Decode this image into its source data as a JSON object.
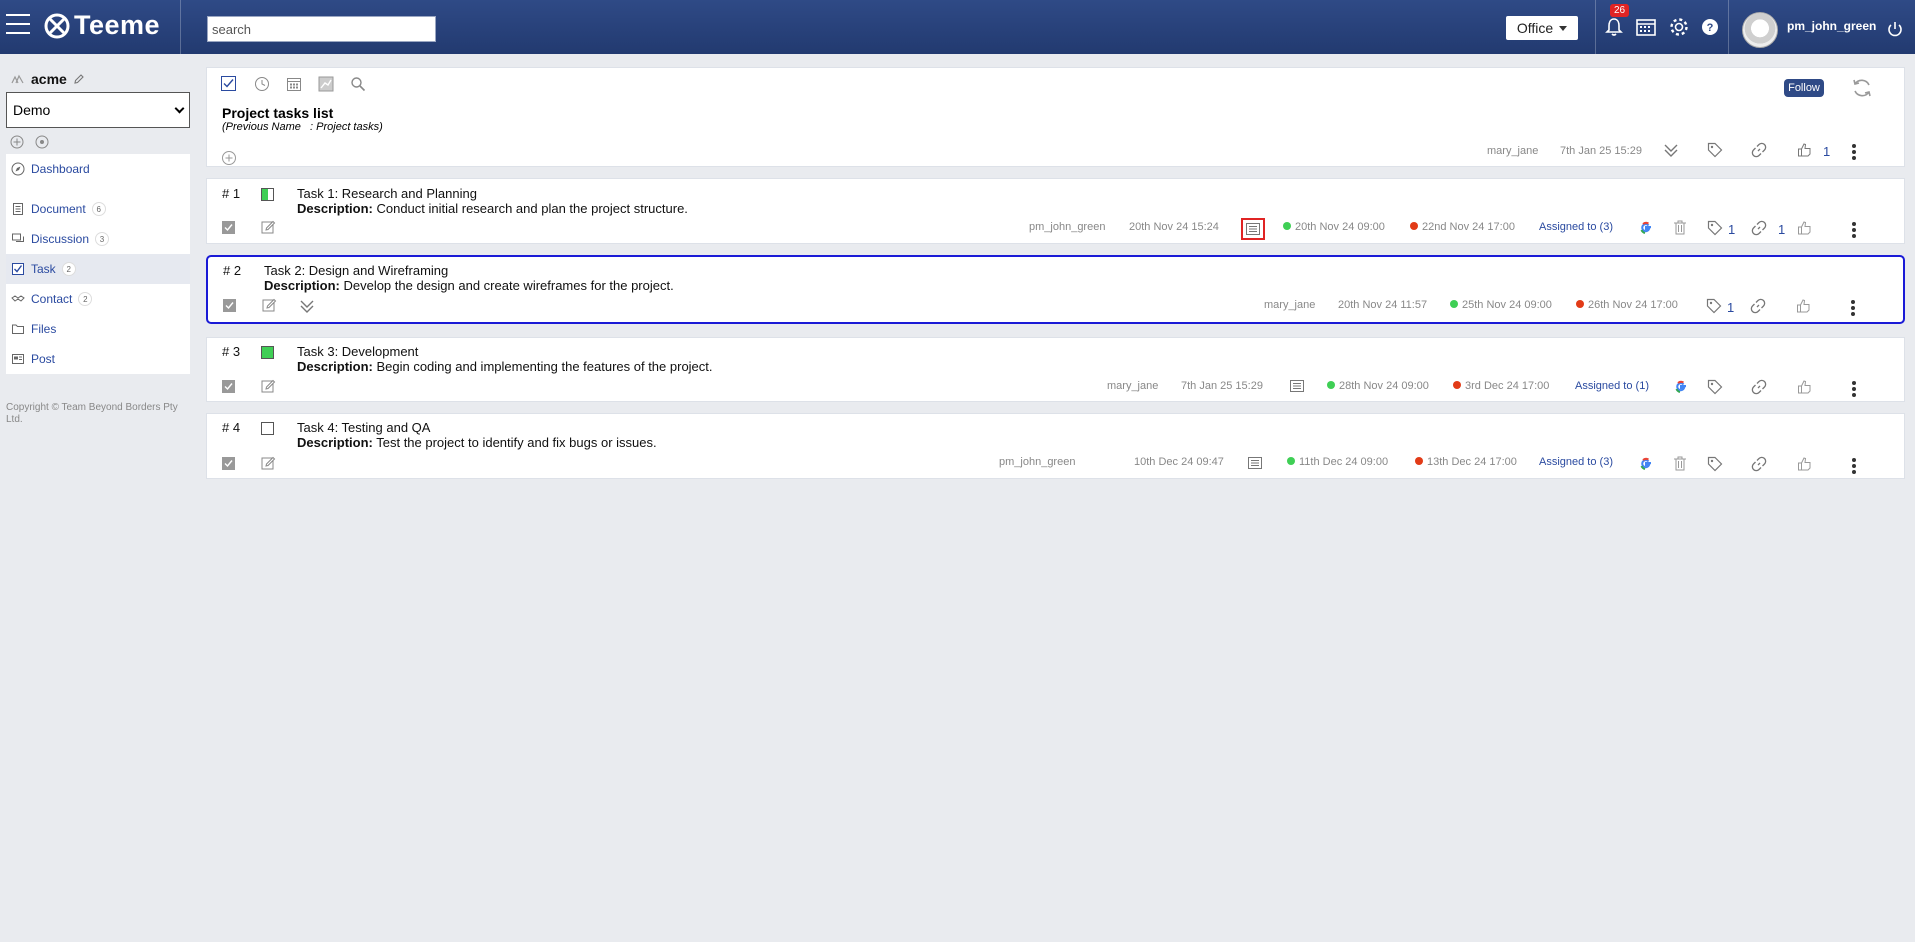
{
  "header": {
    "brand": "Teeme",
    "search_placeholder": "search",
    "office_label": "Office",
    "notification_count": "26",
    "username": "pm_john_green"
  },
  "sidebar": {
    "workspace_name": "acme",
    "space_select": "Demo",
    "items": [
      {
        "label": "Dashboard",
        "count": ""
      },
      {
        "label": "Document",
        "count": "6"
      },
      {
        "label": "Discussion",
        "count": "3"
      },
      {
        "label": "Task",
        "count": "2"
      },
      {
        "label": "Contact",
        "count": "2"
      },
      {
        "label": "Files",
        "count": ""
      },
      {
        "label": "Post",
        "count": ""
      }
    ],
    "copyright": "Copyright © Team Beyond Borders Pty Ltd."
  },
  "list": {
    "title": "Project tasks list",
    "previous_name": "(Previous Name   : Project tasks)",
    "follow_label": "Follow",
    "author": "mary_jane",
    "date": "7th Jan 25 15:29",
    "like_count": "1"
  },
  "tasks": [
    {
      "number": "# 1",
      "title": "Task 1: Research and Planning",
      "desc_label": "Description:",
      "description": "Conduct initial research and plan the project structure.",
      "progress": 0.5,
      "author": "pm_john_green",
      "created": "20th Nov 24 15:24",
      "start": "20th Nov 24 09:00",
      "end": "22nd Nov 24 17:00",
      "assigned": "Assigned to (3)",
      "tag_count": "1",
      "link_count": "1"
    },
    {
      "number": "# 2",
      "title": "Task 2: Design and Wireframing",
      "desc_label": "Description:",
      "description": "Develop the design and create wireframes for the project.",
      "author": "mary_jane",
      "created": "20th Nov 24 11:57",
      "start": "25th Nov 24 09:00",
      "end": "26th Nov 24 17:00",
      "tag_count": "1"
    },
    {
      "number": "# 3",
      "title": "Task 3: Development",
      "desc_label": "Description:",
      "description": "Begin coding and implementing the features of the project.",
      "progress": 1.0,
      "author": "mary_jane",
      "created": "7th Jan 25 15:29",
      "start": "28th Nov 24 09:00",
      "end": "3rd Dec 24 17:00",
      "assigned": "Assigned to (1)"
    },
    {
      "number": "# 4",
      "title": "Task 4: Testing and QA",
      "desc_label": "Description:",
      "description": "Test the project to identify and fix bugs or issues.",
      "progress": 0,
      "author": "pm_john_green",
      "created": "10th Dec 24 09:47",
      "start": "11th Dec 24 09:00",
      "end": "13th Dec 24 17:00",
      "assigned": "Assigned to (3)"
    }
  ],
  "colors": {
    "header_bg": "#2f4a86",
    "link_blue": "#2a4aa0",
    "selected_border": "#1a1ad6",
    "highlight_red": "#e02424",
    "start_green": "#3fcf55",
    "end_red": "#e23b17"
  }
}
